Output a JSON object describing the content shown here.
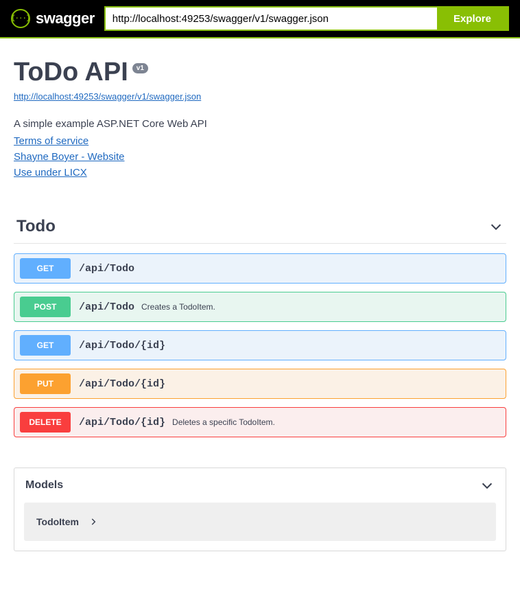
{
  "topbar": {
    "brand_glyph": "{···}",
    "brand_text": "swagger",
    "url_value": "http://localhost:49253/swagger/v1/swagger.json",
    "explore_label": "Explore"
  },
  "info": {
    "title": "ToDo API",
    "version": "v1",
    "spec_url": "http://localhost:49253/swagger/v1/swagger.json",
    "description": "A simple example ASP.NET Core Web API",
    "terms_label": "Terms of service",
    "contact_label": "Shayne Boyer - Website",
    "license_label": "Use under LICX"
  },
  "tag": {
    "name": "Todo"
  },
  "operations": [
    {
      "method": "GET",
      "method_class": "get",
      "path": "/api/Todo",
      "summary": ""
    },
    {
      "method": "POST",
      "method_class": "post",
      "path": "/api/Todo",
      "summary": "Creates a TodoItem."
    },
    {
      "method": "GET",
      "method_class": "get",
      "path": "/api/Todo/{id}",
      "summary": ""
    },
    {
      "method": "PUT",
      "method_class": "put",
      "path": "/api/Todo/{id}",
      "summary": ""
    },
    {
      "method": "DELETE",
      "method_class": "delete",
      "path": "/api/Todo/{id}",
      "summary": "Deletes a specific TodoItem."
    }
  ],
  "models": {
    "heading": "Models",
    "items": [
      {
        "name": "TodoItem"
      }
    ]
  }
}
